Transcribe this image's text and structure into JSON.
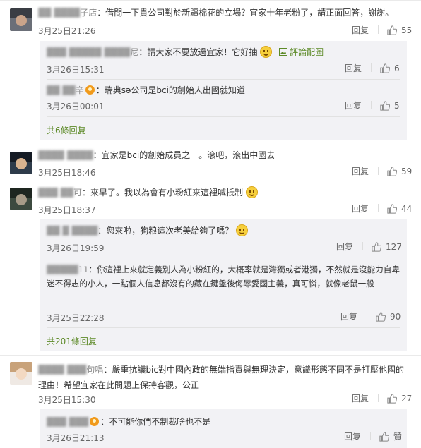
{
  "comments": [
    {
      "name": "子店",
      "text": "：借問一下貴公司對於新疆棉花的立場？宜家十年老粉了，請正面回答，謝謝。",
      "time": "3月25日21:26",
      "reply": "回复",
      "likes": "55"
    },
    {
      "name": "",
      "text": "：宜家是bci的創始成員之一。滾吧，滾出中國去",
      "time": "3月25日18:46",
      "reply": "回复",
      "likes": "59"
    },
    {
      "name": "可",
      "text": "：來早了。我以為會有小粉紅來這裡喊抵制",
      "time": "3月25日18:37",
      "reply": "回复",
      "likes": "44"
    },
    {
      "name": "句唱",
      "text": "：嚴重抗議bic對中國內政的無端指責與無理決定，意識形態不同不是打壓他國的理由！希望宜家在此問題上保持客觀，公正",
      "time": "3月25日15:30",
      "reply": "回复",
      "likes": "27"
    }
  ],
  "replies": [
    {
      "name": "尼",
      "text": "：請大家不要放過宜家！它好抽",
      "extra": "評論配圖",
      "time": "3月26日15:31",
      "reply": "回复",
      "likes": "6"
    },
    {
      "name": "辛",
      "text": "：瑞典sə公司是bci的創始人出國就知道",
      "time": "3月26日00:01",
      "reply": "回复",
      "likes": "5"
    },
    {
      "name": "",
      "text": "：您來啦，狗粮這次老美給夠了嗎？",
      "time": "3月26日19:59",
      "reply": "回复",
      "likes": "127"
    },
    {
      "name": "11",
      "text": "：你這裡上來就定義別人為小粉紅的，大概率就是灣獨或者港獨，不然就是沒能力自卑迷不得志的小人，一點個人信息都沒有的藏在鍵盤後侮辱愛國主義，真可憐，就像老鼠一般",
      "time": "3月25日22:28",
      "reply": "回复",
      "likes": "90"
    },
    {
      "name": "",
      "text": "：不可能你們不制裁啥也不是",
      "time": "3月26日21:13",
      "reply": "回复",
      "likes": "贊"
    }
  ],
  "more": [
    "共6條回复",
    "共201條回复"
  ],
  "colors": {
    "link": "#5d8a28",
    "text": "#333333",
    "meta": "#666666",
    "panel": "#f2f2f5"
  }
}
